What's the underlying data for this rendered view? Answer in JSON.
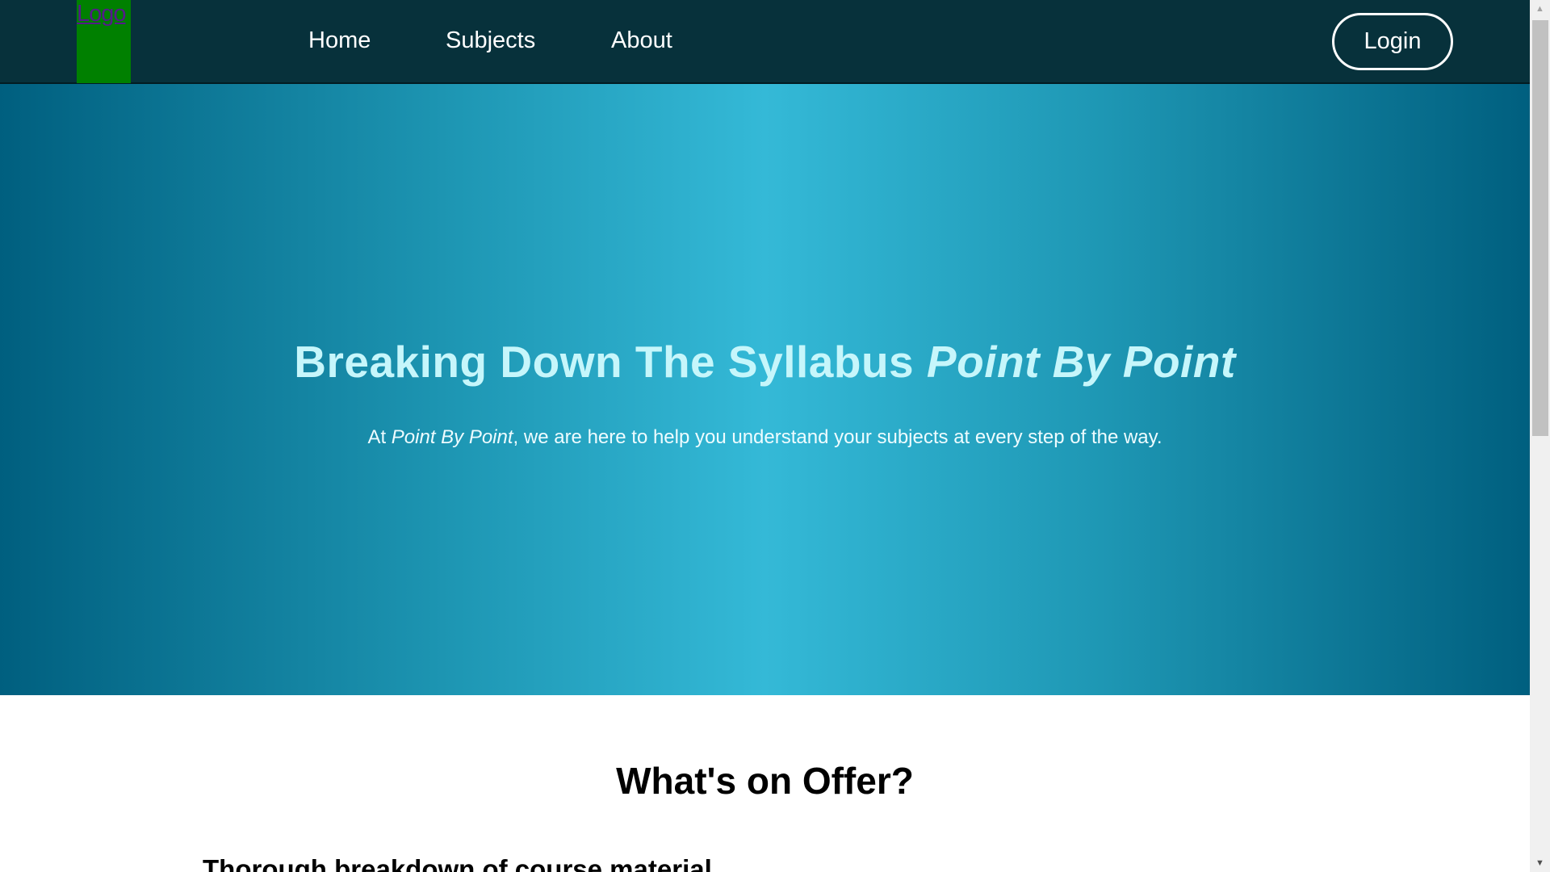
{
  "nav": {
    "logo": "Logo",
    "links": [
      "Home",
      "Subjects",
      "About"
    ],
    "login": "Login"
  },
  "hero": {
    "title_main": "Breaking Down The Syllabus ",
    "title_em": "Point By Point",
    "sub_pre": "At ",
    "sub_em": "Point By Point",
    "sub_post": ", we are here to help you understand your subjects at every step of the way."
  },
  "offer": {
    "heading": "What's on Offer?",
    "features": [
      "Thorough breakdown of course material"
    ]
  },
  "colors": {
    "nav": "#07313b",
    "logo_bg": "#008000",
    "hero_edge": "#005f7f",
    "hero_center": "#34b9d7",
    "title": "#c6f6fb"
  }
}
